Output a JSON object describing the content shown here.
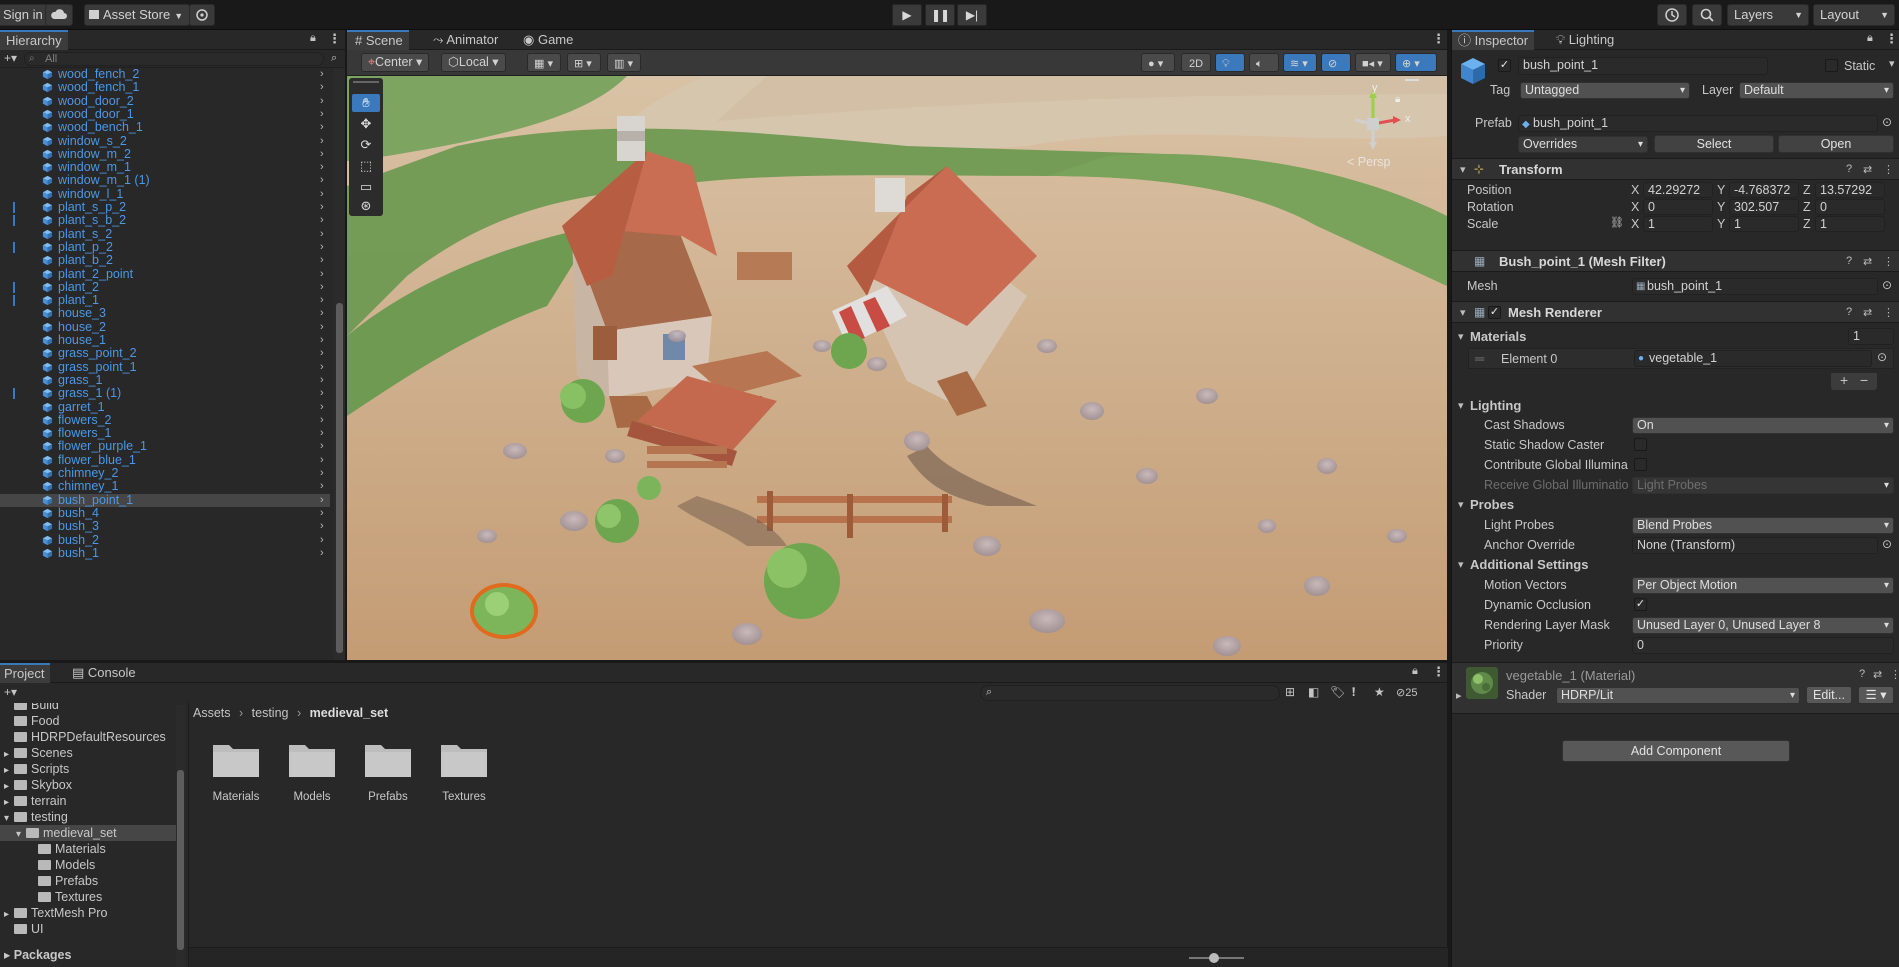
{
  "toolbar": {
    "sign_in": "Sign in",
    "asset_store": "Asset Store",
    "layers": "Layers",
    "layout": "Layout"
  },
  "hierarchy": {
    "tab": "Hierarchy",
    "search_placeholder": "All",
    "items": [
      {
        "label": "wood_fench_2",
        "mark": false
      },
      {
        "label": "wood_fench_1",
        "mark": false
      },
      {
        "label": "wood_door_2",
        "mark": false
      },
      {
        "label": "wood_door_1",
        "mark": false
      },
      {
        "label": "wood_bench_1",
        "mark": false
      },
      {
        "label": "window_s_2",
        "mark": false
      },
      {
        "label": "window_m_2",
        "mark": false
      },
      {
        "label": "window_m_1",
        "mark": false
      },
      {
        "label": "window_m_1 (1)",
        "mark": false
      },
      {
        "label": "window_l_1",
        "mark": false
      },
      {
        "label": "plant_s_p_2",
        "mark": true
      },
      {
        "label": "plant_s_b_2",
        "mark": true
      },
      {
        "label": "plant_s_2",
        "mark": false
      },
      {
        "label": "plant_p_2",
        "mark": true
      },
      {
        "label": "plant_b_2",
        "mark": false
      },
      {
        "label": "plant_2_point",
        "mark": false
      },
      {
        "label": "plant_2",
        "mark": true
      },
      {
        "label": "plant_1",
        "mark": true
      },
      {
        "label": "house_3",
        "mark": false
      },
      {
        "label": "house_2",
        "mark": false
      },
      {
        "label": "house_1",
        "mark": false
      },
      {
        "label": "grass_point_2",
        "mark": false
      },
      {
        "label": "grass_point_1",
        "mark": false
      },
      {
        "label": "grass_1",
        "mark": false
      },
      {
        "label": "grass_1 (1)",
        "mark": true
      },
      {
        "label": "garret_1",
        "mark": false
      },
      {
        "label": "flowers_2",
        "mark": false
      },
      {
        "label": "flowers_1",
        "mark": false
      },
      {
        "label": "flower_purple_1",
        "mark": false
      },
      {
        "label": "flower_blue_1",
        "mark": false
      },
      {
        "label": "chimney_2",
        "mark": false
      },
      {
        "label": "chimney_1",
        "mark": false
      },
      {
        "label": "bush_point_1",
        "mark": false,
        "selected": true
      },
      {
        "label": "bush_4",
        "mark": false
      },
      {
        "label": "bush_3",
        "mark": false
      },
      {
        "label": "bush_2",
        "mark": false
      },
      {
        "label": "bush_1",
        "mark": false
      }
    ]
  },
  "scene": {
    "tabs": [
      "Scene",
      "Animator",
      "Game"
    ],
    "pivot": "Center",
    "space": "Local",
    "mode_2d": "2D",
    "persp": "< Persp",
    "gizmo_y": "y",
    "gizmo_x": "x"
  },
  "inspector": {
    "tabs": [
      "Inspector",
      "Lighting"
    ],
    "object_name": "bush_point_1",
    "static": "Static",
    "tag_label": "Tag",
    "tag_value": "Untagged",
    "layer_label": "Layer",
    "layer_value": "Default",
    "prefab_label": "Prefab",
    "prefab_value": "bush_point_1",
    "overrides": "Overrides",
    "select": "Select",
    "open": "Open",
    "transform": {
      "title": "Transform",
      "rows": [
        {
          "label": "Position",
          "x": "42.29272",
          "y": "-4.768372",
          "z": "13.57292"
        },
        {
          "label": "Rotation",
          "x": "0",
          "y": "302.507",
          "z": "0"
        },
        {
          "label": "Scale",
          "x": "1",
          "y": "1",
          "z": "1"
        }
      ]
    },
    "axis_x": "X",
    "axis_y": "Y",
    "axis_z": "Z",
    "mesh_filter": {
      "title": "Bush_point_1 (Mesh Filter)",
      "mesh_label": "Mesh",
      "mesh_value": "bush_point_1"
    },
    "mesh_renderer": {
      "title": "Mesh Renderer",
      "materials_label": "Materials",
      "materials_count": "1",
      "element_label": "Element 0",
      "element_value": "vegetable_1",
      "lighting": "Lighting",
      "cast_shadows_label": "Cast Shadows",
      "cast_shadows_value": "On",
      "static_shadow_label": "Static Shadow Caster",
      "contribute_gi_label": "Contribute Global Illumina",
      "receive_gi_label": "Receive Global Illuminatio",
      "receive_gi_value": "Light Probes",
      "probes": "Probes",
      "light_probes_label": "Light Probes",
      "light_probes_value": "Blend Probes",
      "anchor_label": "Anchor Override",
      "anchor_value": "None (Transform)",
      "additional": "Additional Settings",
      "motion_label": "Motion Vectors",
      "motion_value": "Per Object Motion",
      "dynamic_occ_label": "Dynamic Occlusion",
      "render_layer_label": "Rendering Layer Mask",
      "render_layer_value": "Unused Layer 0, Unused Layer 8",
      "priority_label": "Priority",
      "priority_value": "0"
    },
    "material": {
      "title": "vegetable_1 (Material)",
      "shader_label": "Shader",
      "shader_value": "HDRP/Lit",
      "edit": "Edit..."
    },
    "add_component": "Add Component"
  },
  "project": {
    "tabs": [
      "Project",
      "Console"
    ],
    "hidden_count": "25",
    "tree": [
      {
        "label": "Build",
        "indent": 0,
        "arrow": ""
      },
      {
        "label": "Food",
        "indent": 0,
        "arrow": ""
      },
      {
        "label": "HDRPDefaultResources",
        "indent": 0,
        "arrow": ""
      },
      {
        "label": "Scenes",
        "indent": 0,
        "arrow": "▸"
      },
      {
        "label": "Scripts",
        "indent": 0,
        "arrow": "▸"
      },
      {
        "label": "Skybox",
        "indent": 0,
        "arrow": "▸"
      },
      {
        "label": "terrain",
        "indent": 0,
        "arrow": "▸"
      },
      {
        "label": "testing",
        "indent": 0,
        "arrow": "▾"
      },
      {
        "label": "medieval_set",
        "indent": 1,
        "arrow": "▾",
        "selected": true
      },
      {
        "label": "Materials",
        "indent": 2,
        "arrow": ""
      },
      {
        "label": "Models",
        "indent": 2,
        "arrow": ""
      },
      {
        "label": "Prefabs",
        "indent": 2,
        "arrow": ""
      },
      {
        "label": "Textures",
        "indent": 2,
        "arrow": ""
      },
      {
        "label": "TextMesh Pro",
        "indent": 0,
        "arrow": "▸"
      },
      {
        "label": "UI",
        "indent": 0,
        "arrow": ""
      }
    ],
    "packages": "Packages",
    "breadcrumb": [
      "Assets",
      "testing",
      "medieval_set"
    ],
    "folders": [
      "Materials",
      "Models",
      "Prefabs",
      "Textures"
    ]
  }
}
